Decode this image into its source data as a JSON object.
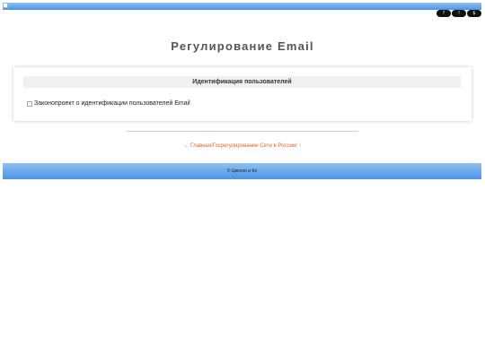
{
  "top_buttons": [
    "?",
    "!",
    "$"
  ],
  "page_title": "Регулирование Email",
  "card": {
    "header": "Идентификация пользователей",
    "item": "Законопроект о идентификации пользователей Email"
  },
  "nav": {
    "back": "← Главная",
    "separator": "/",
    "parent": "Госрегулирование Сети в России",
    "up": "/ ↑"
  },
  "footer": "© Циклоп и Ко"
}
